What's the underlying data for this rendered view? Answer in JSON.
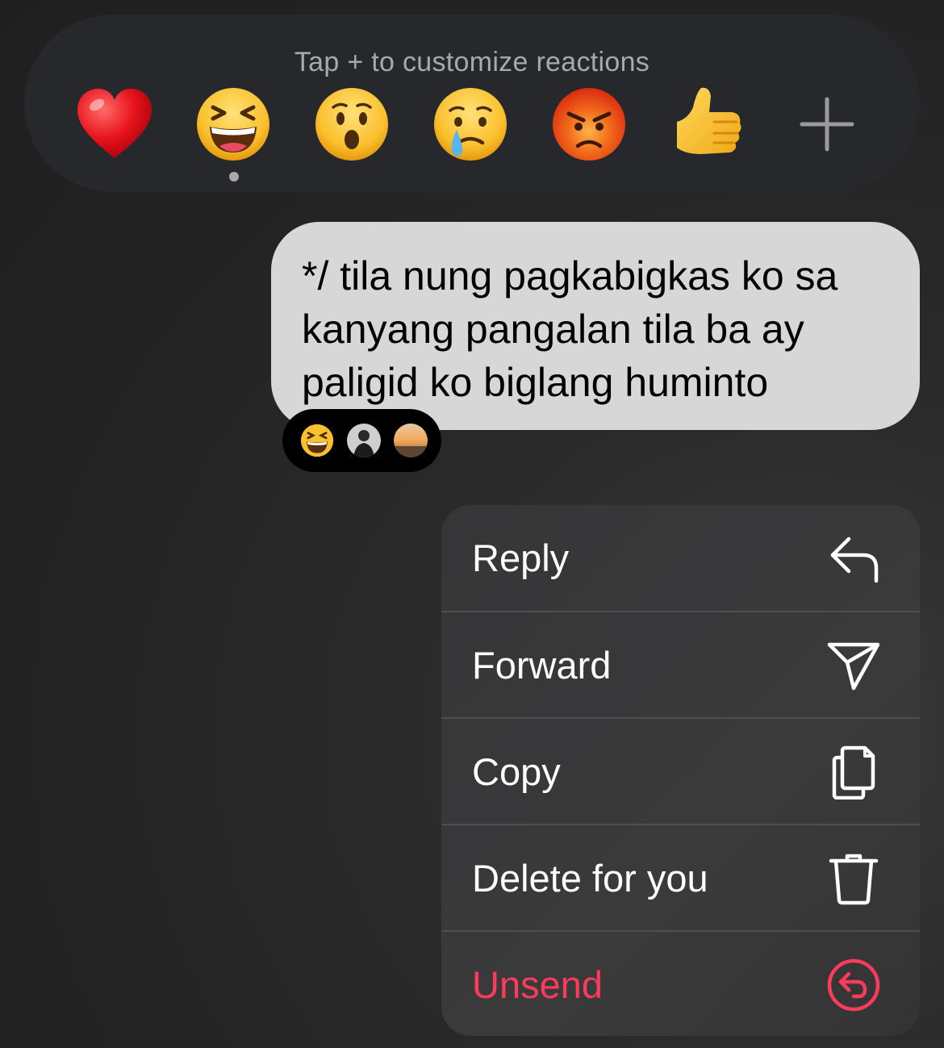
{
  "reaction_bar": {
    "hint": "Tap + to customize reactions",
    "emojis": [
      {
        "name": "red-heart",
        "glyph": "❤️"
      },
      {
        "name": "laughing-face",
        "glyph": "😆"
      },
      {
        "name": "surprised-face",
        "glyph": "😮"
      },
      {
        "name": "crying-face",
        "glyph": "😢"
      },
      {
        "name": "angry-face",
        "glyph": "😡"
      },
      {
        "name": "thumbs-up",
        "glyph": "👍"
      }
    ],
    "add_icon": "plus-icon",
    "selected_index": 1
  },
  "message": {
    "text": "*/ tila nung pagkabigkas ko sa kanyang pangalan tila ba ay paligid ko biglang huminto"
  },
  "message_reactions": {
    "emoji": "😆",
    "avatars": [
      "avatar-1",
      "avatar-2"
    ]
  },
  "menu": {
    "items": [
      {
        "label": "Reply",
        "icon": "reply-icon"
      },
      {
        "label": "Forward",
        "icon": "send-icon"
      },
      {
        "label": "Copy",
        "icon": "copy-icon"
      },
      {
        "label": "Delete for you",
        "icon": "trash-icon"
      },
      {
        "label": "Unsend",
        "icon": "unsend-icon",
        "color": "#ff3b5c"
      }
    ]
  },
  "colors": {
    "background": "#232323",
    "bubble": "#d7d7d7",
    "menu": "#38383a",
    "danger": "#ff3b5c"
  }
}
